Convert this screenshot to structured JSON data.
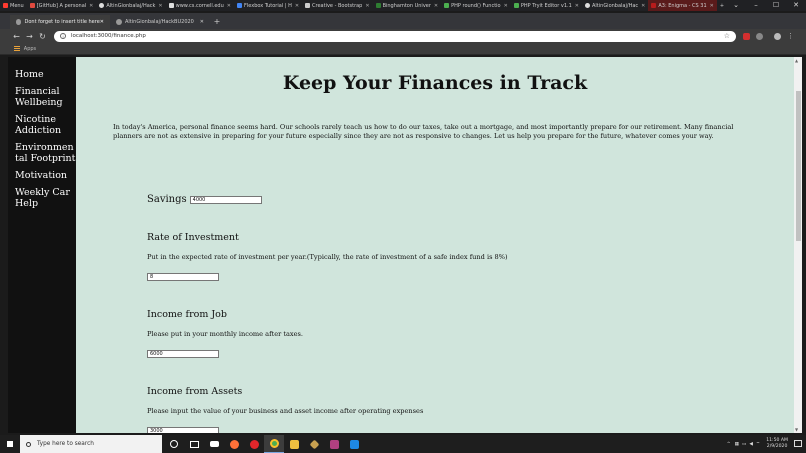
{
  "os_tabs": [
    {
      "label": "Menu",
      "color": "#ff3b30"
    },
    {
      "label": "[GitHub] A personal",
      "color": "#e04a3f"
    },
    {
      "label": "AltinGionbalaj/Hack",
      "color": "#dddddd"
    },
    {
      "label": "www.cs.cornell.edu",
      "color": "#dddddd"
    },
    {
      "label": "Flexbox Tutorial | H",
      "color": "#4285f4"
    },
    {
      "label": "Creative - Bootstrap",
      "color": "#cccccc"
    },
    {
      "label": "Binghamton Univer",
      "color": "#2e7d32"
    },
    {
      "label": "PHP round() Functio",
      "color": "#4caf50"
    },
    {
      "label": "PHP Tryit Editor v1.1",
      "color": "#4caf50"
    },
    {
      "label": "AltinGionbalaj/Hac",
      "color": "#dddddd"
    },
    {
      "label": "A3: Enigma - CS 31",
      "color": "#b71c1c"
    }
  ],
  "browser": {
    "tabs": [
      {
        "label": "Dont forget to insert title here",
        "active": true
      },
      {
        "label": "AltinGionbalaj/HackBU2020",
        "active": false
      }
    ],
    "new_tab": "+",
    "url": "localhost:3000/finance.php",
    "bookmarks": [
      {
        "label": "Apps"
      }
    ]
  },
  "sidebar": {
    "items": [
      {
        "label": "Home"
      },
      {
        "label": "Financial Wellbeing"
      },
      {
        "label": "Nicotine Addiction"
      },
      {
        "label": "Environmental Footprint"
      },
      {
        "label": "Motivation"
      },
      {
        "label": "Weekly Car Help"
      }
    ]
  },
  "main": {
    "title": "Keep Your Finances in Track",
    "intro": "In today's America, personal finance seems hard. Our schools rarely teach us how to do our taxes, take out a mortgage, and most importantly prepare for our retirement. Many financial planners are not as extensive in preparing for your future especially since they are not as responsive to changes. Let us help you prepare for the future, whatever comes your way.",
    "savings": {
      "label": "Savings",
      "value": "4000"
    },
    "rate": {
      "heading": "Rate of Investment",
      "text": "Put in the expected rate of investment per year.(Typically, the rate of investment of a safe index fund is 8%)",
      "value": "8"
    },
    "income_job": {
      "heading": "Income from Job",
      "text": "Please put in your monthly income after taxes.",
      "value": "6000"
    },
    "income_assets": {
      "heading": "Income from Assets",
      "text": "Please input the value of your business and asset income after operating expenses",
      "value": "3000"
    }
  },
  "taskbar": {
    "search_placeholder": "Type here to search",
    "time": "11:50 AM",
    "date": "2/9/2020"
  }
}
